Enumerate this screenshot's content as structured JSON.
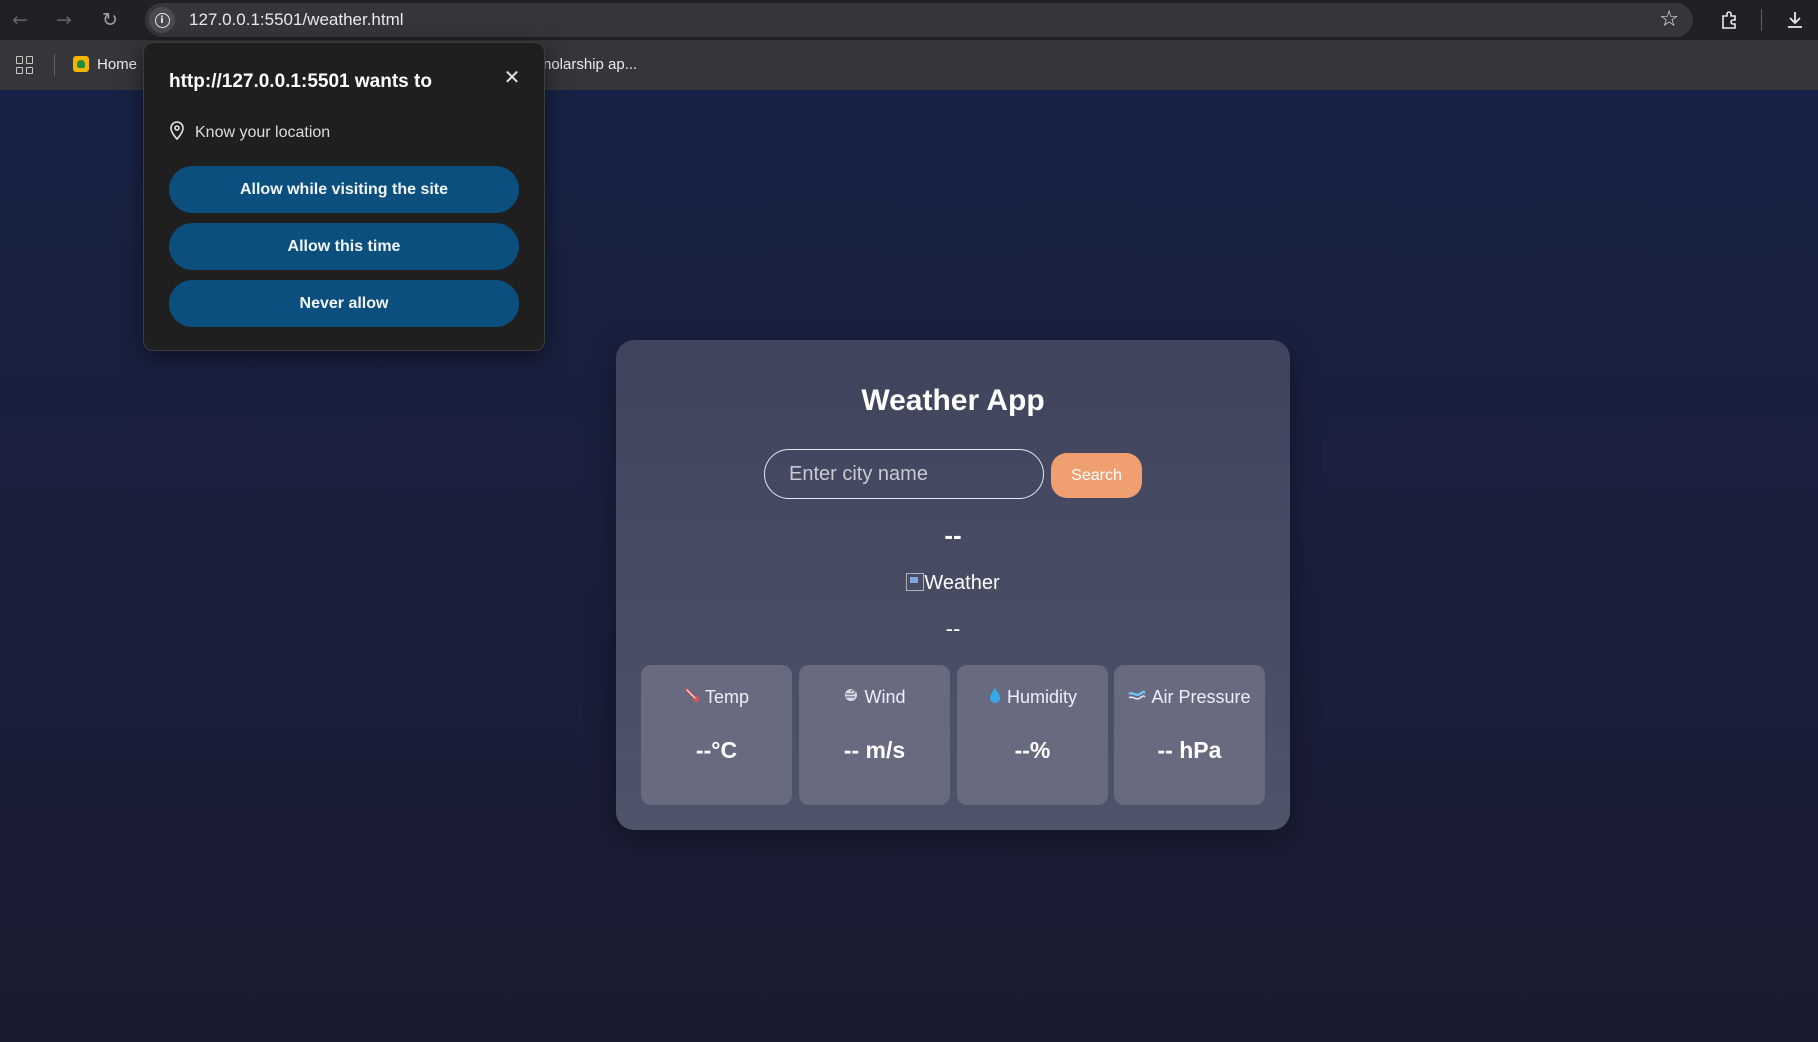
{
  "browser": {
    "url": "127.0.0.1:5501/weather.html",
    "bookmarks": {
      "home_label": "Home",
      "partial_label": "nolarship ap..."
    }
  },
  "permission_prompt": {
    "title": "http://127.0.0.1:5501 wants to",
    "permission": "Know your location",
    "allow_visiting": "Allow while visiting the site",
    "allow_once": "Allow this time",
    "never": "Never allow"
  },
  "app": {
    "title": "Weather App",
    "search": {
      "placeholder": "Enter city name",
      "button_label": "Search"
    },
    "city": "--",
    "image_alt": "Weather",
    "description": "--",
    "stats": [
      {
        "icon": "thermometer-icon",
        "label": "Temp",
        "value": "--°C"
      },
      {
        "icon": "wind-icon",
        "label": "Wind",
        "value": "-- m/s"
      },
      {
        "icon": "droplet-icon",
        "label": "Humidity",
        "value": "--%"
      },
      {
        "icon": "pressure-icon",
        "label": "Air Pressure",
        "value": "-- hPa"
      }
    ]
  },
  "colors": {
    "page_background_top": "#172346",
    "page_background_bottom": "#1a1b30",
    "card_background": "#464a62",
    "stat_tile": "#686a80",
    "search_button": "#f0a070",
    "permission_button": "#0b4f7f"
  }
}
